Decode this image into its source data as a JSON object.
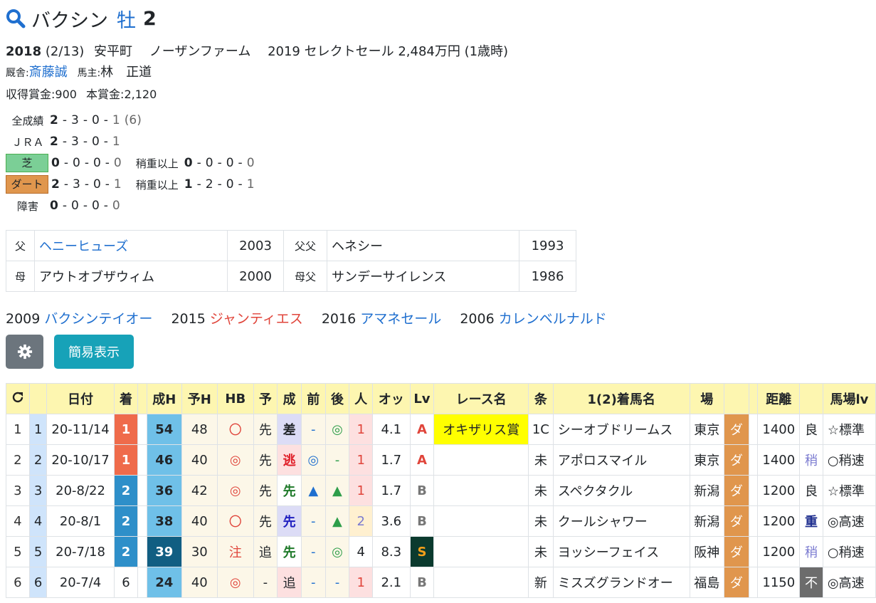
{
  "horse": {
    "name": "バクシン",
    "sex": "牡",
    "age": "2",
    "birth_year": "2018",
    "birth_date": "(2/13)",
    "birthplace": "安平町",
    "breeder": "ノーザンファーム",
    "sale": "2019 セレクトセール 2,484万円 (1歳時)",
    "trainer_label": "厩舎:",
    "trainer": "斎藤誠",
    "owner_label": "馬主:",
    "owner": "林　正道",
    "earn_label": "収得賞金:",
    "earn_value": "900",
    "prize_label": "本賞金:",
    "prize_value": "2,120"
  },
  "records": [
    {
      "label": "全成績",
      "v": [
        "2",
        "3",
        "0",
        "1"
      ],
      "extra": "(6)"
    },
    {
      "label": "ＪＲＡ",
      "v": [
        "2",
        "3",
        "0",
        "1"
      ]
    },
    {
      "label": "芝",
      "v": [
        "0",
        "0",
        "0",
        "0"
      ],
      "cond_label": "稍重以上",
      "cv": [
        "0",
        "0",
        "0",
        "0"
      ]
    },
    {
      "label": "ダート",
      "v": [
        "2",
        "3",
        "0",
        "1"
      ],
      "cond_label": "稍重以上",
      "cv": [
        "1",
        "2",
        "0",
        "1"
      ]
    },
    {
      "label": "障害",
      "v": [
        "0",
        "0",
        "0",
        "0"
      ]
    }
  ],
  "pedigree": {
    "sire_label": "父",
    "sire": "ヘニーヒューズ",
    "sire_year": "2003",
    "sire_sire_label": "父父",
    "sire_sire": "ヘネシー",
    "sire_sire_year": "1993",
    "dam_label": "母",
    "dam": "アウトオブザウィム",
    "dam_year": "2000",
    "dam_sire_label": "母父",
    "dam_sire": "サンデーサイレンス",
    "dam_sire_year": "1986"
  },
  "siblings": [
    {
      "year": "2009",
      "name": "バクシンテイオー",
      "color": "blue"
    },
    {
      "year": "2015",
      "name": "ジャンティエス",
      "color": "red"
    },
    {
      "year": "2016",
      "name": "アマネセール",
      "color": "blue"
    },
    {
      "year": "2006",
      "name": "カレンベルナルド",
      "color": "blue"
    }
  ],
  "buttons": {
    "simple_label": "簡易表示"
  },
  "table": {
    "headers": [
      "日付",
      "着",
      "成H",
      "予H",
      "HB",
      "予",
      "成",
      "前",
      "後",
      "人",
      "オッ",
      "Lv",
      "レース名",
      "条",
      "1(2)着馬名",
      "場",
      "距離",
      "馬場lv"
    ],
    "rows": [
      {
        "i": "1",
        "no": "1",
        "date": "20-11/14",
        "place": "1",
        "seiH": "54",
        "yoH": "48",
        "hb": "〇",
        "yo": "先",
        "sei": "差",
        "mae": "-",
        "ato": "◎",
        "pop": "1",
        "odds": "4.1",
        "lv": "A",
        "race": "オキザリス賞",
        "cls": "1C",
        "winner": "シーオブドリームス",
        "track": "東京",
        "surf": "ダ",
        "dist": "1400",
        "cond": "良",
        "lvtxt": "☆標準"
      },
      {
        "i": "2",
        "no": "2",
        "date": "20-10/17",
        "place": "1",
        "seiH": "46",
        "yoH": "40",
        "hb": "◎",
        "yo": "先",
        "sei": "逃",
        "mae": "◎",
        "ato": "-",
        "pop": "1",
        "odds": "1.7",
        "lv": "A",
        "race": "",
        "cls": "未",
        "winner": "アポロスマイル",
        "track": "東京",
        "surf": "ダ",
        "dist": "1400",
        "cond": "稍",
        "lvtxt": "○稍速"
      },
      {
        "i": "3",
        "no": "3",
        "date": "20-8/22",
        "place": "2",
        "seiH": "36",
        "yoH": "42",
        "hb": "◎",
        "yo": "先",
        "sei": "先",
        "mae": "▲",
        "ato": "▲",
        "pop": "1",
        "odds": "1.7",
        "lv": "B",
        "race": "",
        "cls": "未",
        "winner": "スペクタクル",
        "track": "新潟",
        "surf": "ダ",
        "dist": "1200",
        "cond": "良",
        "lvtxt": "☆標準"
      },
      {
        "i": "4",
        "no": "4",
        "date": "20-8/1",
        "place": "2",
        "seiH": "38",
        "yoH": "40",
        "hb": "〇",
        "yo": "先",
        "sei": "先",
        "mae": "-",
        "ato": "▲",
        "pop": "2",
        "odds": "3.6",
        "lv": "B",
        "race": "",
        "cls": "未",
        "winner": "クールシャワー",
        "track": "新潟",
        "surf": "ダ",
        "dist": "1200",
        "cond": "重",
        "lvtxt": "◎高速"
      },
      {
        "i": "5",
        "no": "5",
        "date": "20-7/18",
        "place": "2",
        "seiH": "39",
        "yoH": "30",
        "hb": "注",
        "yo": "追",
        "sei": "先",
        "mae": "-",
        "ato": "◎",
        "pop": "4",
        "odds": "8.3",
        "lv": "S",
        "race": "",
        "cls": "未",
        "winner": "ヨッシーフェイス",
        "track": "阪神",
        "surf": "ダ",
        "dist": "1200",
        "cond": "稍",
        "lvtxt": "○稍速"
      },
      {
        "i": "6",
        "no": "6",
        "date": "20-7/4",
        "place": "6",
        "seiH": "24",
        "yoH": "40",
        "hb": "◎",
        "yo": "-",
        "sei": "追",
        "mae": "-",
        "ato": "-",
        "pop": "1",
        "odds": "2.1",
        "lv": "B",
        "race": "",
        "cls": "新",
        "winner": "ミスズグランドオー",
        "track": "福島",
        "surf": "ダ",
        "dist": "1150",
        "cond": "不",
        "lvtxt": "◎高速"
      }
    ]
  }
}
